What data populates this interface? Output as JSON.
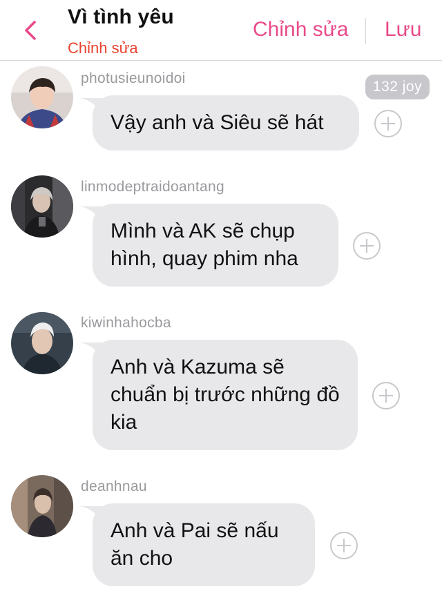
{
  "header": {
    "title": "Vì tình yêu",
    "subtitle": "Chỉnh sửa",
    "edit_label": "Chỉnh sửa",
    "save_label": "Lưu",
    "accent_color": "#e94a8a",
    "subtitle_color": "#e8422f",
    "back_icon": "chevron-left-icon"
  },
  "messages": [
    {
      "username": "photusieunoidoi",
      "text": "Vậy anh và Siêu sẽ hát",
      "badge": "132 joy"
    },
    {
      "username": "linmodeptraidoantang",
      "text": "Mình và AK sẽ chụp hình, quay phim nha"
    },
    {
      "username": "kiwinhahocba",
      "text": "Anh và Kazuma sẽ chuẩn bị trước những đồ kia"
    },
    {
      "username": "deanhnau",
      "text": "Anh và Pai sẽ nấu ăn cho"
    }
  ],
  "colors": {
    "bubble": "#e8e8eb",
    "username": "#9a9a9e",
    "badge_bg": "#c7c7cc",
    "add_icon": "#c8c8cc"
  },
  "icons": {
    "add": "plus-circle-icon",
    "back": "chevron-left-icon"
  }
}
